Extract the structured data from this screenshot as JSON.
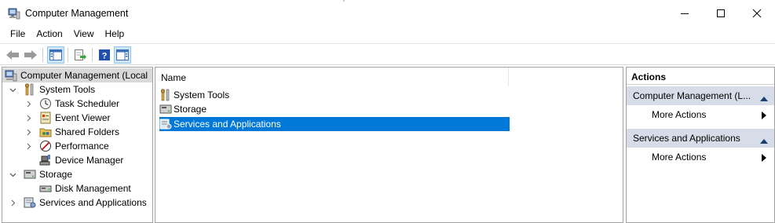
{
  "window": {
    "title": "Computer Management",
    "icon": "computer-management-icon"
  },
  "menu": [
    "File",
    "Action",
    "View",
    "Help"
  ],
  "toolbar": {
    "buttons": [
      "back-arrow-icon",
      "forward-arrow-icon",
      "show-hide-console-tree-icon",
      "export-list-icon",
      "help-icon",
      "show-hide-action-pane-icon"
    ]
  },
  "tree": {
    "root": "Computer Management (Local",
    "items": [
      {
        "label": "System Tools",
        "icon": "system-tools-icon"
      },
      {
        "label": "Task Scheduler",
        "icon": "clock-icon"
      },
      {
        "label": "Event Viewer",
        "icon": "event-viewer-icon"
      },
      {
        "label": "Shared Folders",
        "icon": "shared-folders-icon"
      },
      {
        "label": "Performance",
        "icon": "performance-icon"
      },
      {
        "label": "Device Manager",
        "icon": "device-manager-icon"
      },
      {
        "label": "Storage",
        "icon": "storage-icon"
      },
      {
        "label": "Disk Management",
        "icon": "disk-icon"
      },
      {
        "label": "Services and Applications",
        "icon": "services-icon"
      }
    ]
  },
  "list": {
    "column": "Name",
    "rows": [
      "System Tools",
      "Storage",
      "Services and Applications"
    ],
    "selected_index": 2
  },
  "actions": {
    "header": "Actions",
    "groups": [
      {
        "title": "Computer Management (L...",
        "item": "More Actions"
      },
      {
        "title": "Services and Applications",
        "item": "More Actions"
      }
    ]
  },
  "colors": {
    "selection": "#0078d7",
    "action_group_bg": "#d6dde8",
    "tree_selected_bg": "#d9d9d9"
  }
}
